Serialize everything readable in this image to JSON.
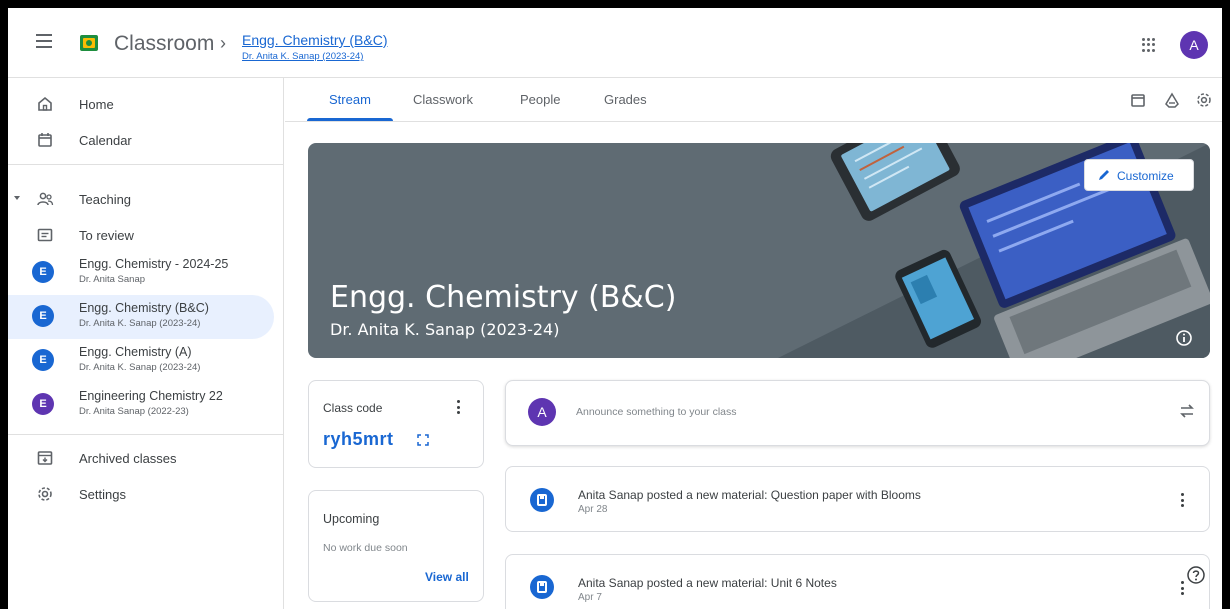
{
  "app": {
    "title": "Classroom",
    "breadcrumb_separator": "›",
    "class_title": "Engg. Chemistry (B&C)",
    "class_subtitle": "Dr. Anita K. Sanap (2023-24)",
    "account_initial": "A"
  },
  "sidebar": {
    "home": "Home",
    "calendar": "Calendar",
    "teaching": "Teaching",
    "to_review": "To review",
    "classes": [
      {
        "initial": "E",
        "title": "Engg. Chemistry - 2024-25",
        "subtitle": "Dr. Anita Sanap",
        "color": "#1967d2"
      },
      {
        "initial": "E",
        "title": "Engg. Chemistry (B&C)",
        "subtitle": "Dr. Anita K. Sanap (2023-24)",
        "color": "#1967d2"
      },
      {
        "initial": "E",
        "title": "Engg. Chemistry (A)",
        "subtitle": "Dr. Anita K. Sanap (2023-24)",
        "color": "#1967d2"
      },
      {
        "initial": "E",
        "title": "Engineering Chemistry 22",
        "subtitle": "Dr. Anita Sanap (2022-23)",
        "color": "#5e35b1"
      }
    ],
    "archived": "Archived classes",
    "settings": "Settings"
  },
  "tabs": [
    "Stream",
    "Classwork",
    "People",
    "Grades"
  ],
  "banner": {
    "title": "Engg. Chemistry (B&C)",
    "subtitle": "Dr. Anita K. Sanap (2023-24)",
    "customize": "Customize"
  },
  "class_code": {
    "label": "Class code",
    "value": "ryh5mrt"
  },
  "upcoming": {
    "title": "Upcoming",
    "empty": "No work due soon",
    "link": "View all"
  },
  "announce": {
    "avatar": "A",
    "placeholder": "Announce something to your class"
  },
  "posts": [
    {
      "title": "Anita Sanap posted a new material: Question paper with Blooms",
      "date": "Apr 28"
    },
    {
      "title": "Anita Sanap posted a new material: Unit 6 Notes",
      "date": "Apr 7"
    }
  ]
}
